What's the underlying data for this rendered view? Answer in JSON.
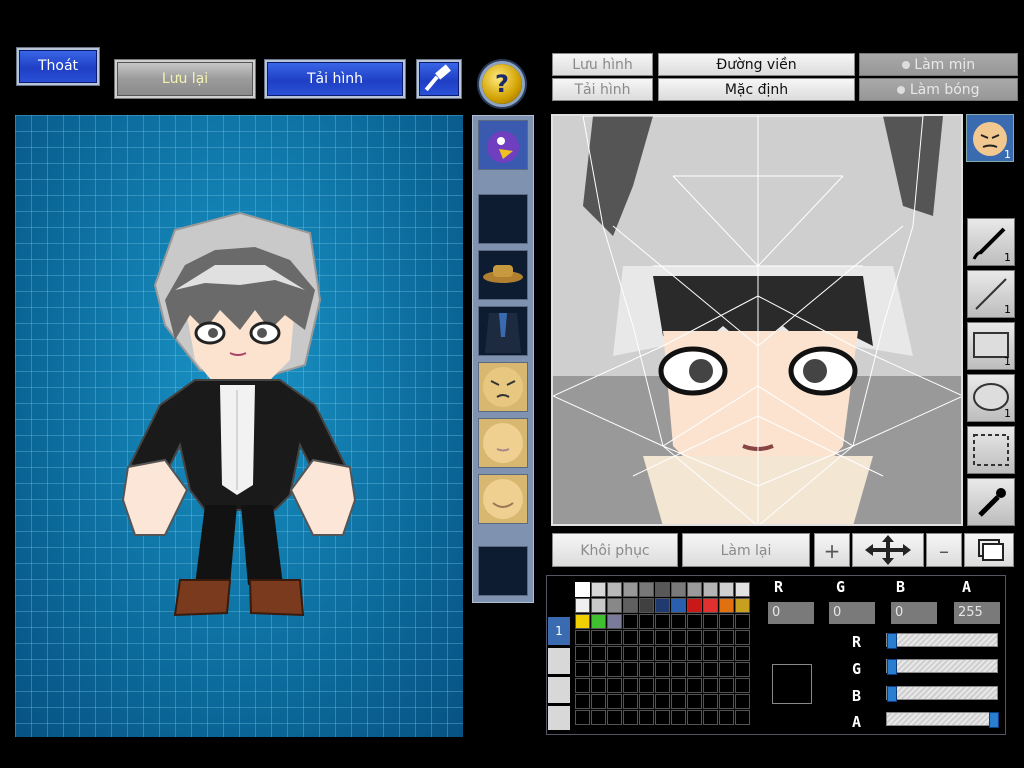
{
  "toolbar": {
    "exit_label": "Thoát",
    "save_label": "Lưu lại",
    "load_label": "Tải hình",
    "help_glyph": "?"
  },
  "editor_buttons": {
    "save_image": "Lưu hình",
    "load_image": "Tải hình",
    "outline": "Đường viền",
    "default": "Mặc định",
    "smooth": "Làm mịn",
    "shine": "Làm bóng",
    "restore": "Khôi phục",
    "redo": "Làm lại"
  },
  "layer_badge": "1",
  "tools": [
    {
      "name": "brush-tool",
      "num": "1"
    },
    {
      "name": "line-tool",
      "num": "1"
    },
    {
      "name": "rectangle-tool",
      "num": "1"
    },
    {
      "name": "ellipse-tool",
      "num": "1"
    },
    {
      "name": "select-tool",
      "num": ""
    },
    {
      "name": "eyedropper-tool",
      "num": ""
    }
  ],
  "color_channels": {
    "r_value": "0",
    "g_value": "0",
    "b_value": "0",
    "a_value": "255",
    "r_label": "R",
    "g_label": "G",
    "b_label": "B",
    "a_label": "A"
  },
  "palette_tab": "1",
  "palette_colors": [
    "#ffffff",
    "#d8d8d8",
    "#b8b8b8",
    "#989898",
    "#787878",
    "#585858",
    "#7a7a7a",
    "#9a9a9a",
    "#b5b5b5",
    "#cfcfcf",
    "#e3e3e3",
    "#f0f0f0",
    "#c8c8c8",
    "#888888",
    "#606060",
    "#404040",
    "#1e3a6e",
    "#2a5fb0",
    "#c81818",
    "#e03030",
    "#e07010",
    "#c8a020",
    "#f0d000",
    "#40c030",
    "#7a7a9a"
  ],
  "colors": {
    "accent": "#2a52d8",
    "stage": "#0d6fa0",
    "slider_knob": "#2a7ed0"
  }
}
